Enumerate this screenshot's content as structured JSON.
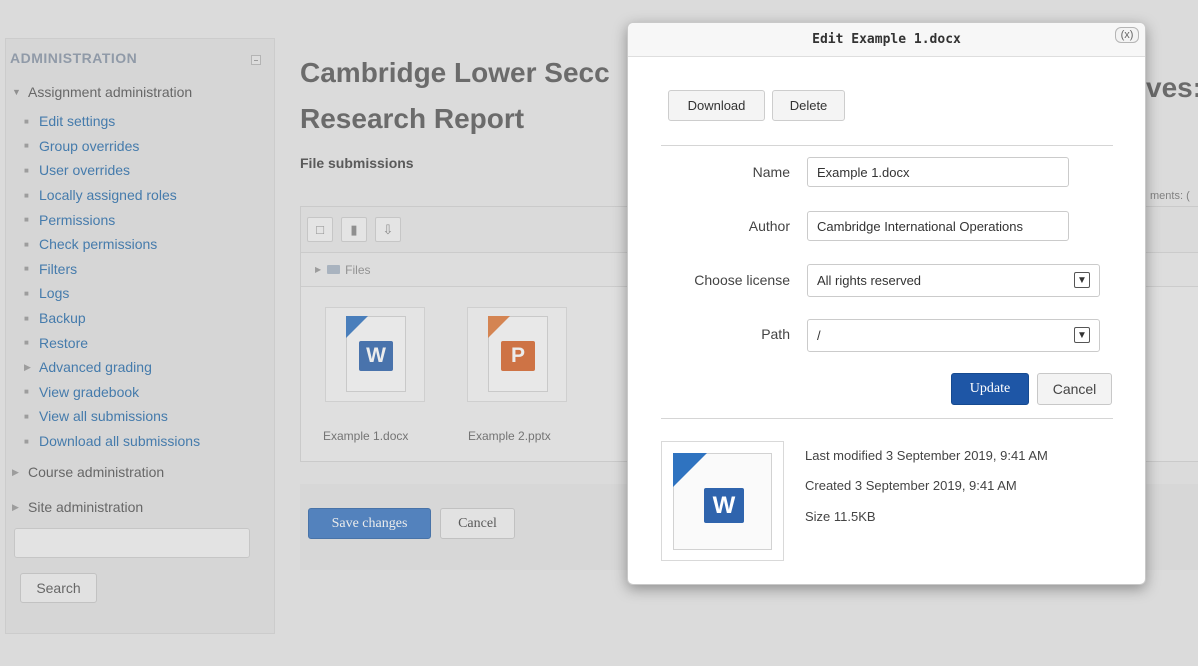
{
  "sidebar": {
    "heading": "ADMINISTRATION",
    "assignment_admin": "Assignment administration",
    "items": [
      {
        "label": "Edit settings"
      },
      {
        "label": "Group overrides"
      },
      {
        "label": "User overrides"
      },
      {
        "label": "Locally assigned roles"
      },
      {
        "label": "Permissions"
      },
      {
        "label": "Check permissions"
      },
      {
        "label": "Filters"
      },
      {
        "label": "Logs"
      },
      {
        "label": "Backup"
      },
      {
        "label": "Restore"
      },
      {
        "label": "Advanced grading"
      },
      {
        "label": "View gradebook"
      },
      {
        "label": "View all submissions"
      },
      {
        "label": "Download all submissions"
      }
    ],
    "course_admin": "Course administration",
    "site_admin": "Site administration",
    "search_value": "",
    "search_button": "Search"
  },
  "main": {
    "title_line1": "Cambridge Lower Secc",
    "title_line2": "Research Report",
    "title_peek": "ves:",
    "comments_peek": "ments: (",
    "file_submissions": "File submissions",
    "path_label": "Files",
    "files": [
      {
        "name": "Example 1.docx",
        "icon": "word-file-icon",
        "letter": "W"
      },
      {
        "name": "Example 2.pptx",
        "icon": "powerpoint-file-icon",
        "letter": "P"
      }
    ],
    "save_button": "Save changes",
    "cancel_button": "Cancel"
  },
  "dialog": {
    "title": "Edit Example 1.docx",
    "close_label": "(x)",
    "download_button": "Download",
    "delete_button": "Delete",
    "fields": {
      "name_label": "Name",
      "name_value": "Example 1.docx",
      "author_label": "Author",
      "author_value": "Cambridge International Operations",
      "license_label": "Choose license",
      "license_value": "All rights reserved",
      "path_label": "Path",
      "path_value": "/"
    },
    "update_button": "Update",
    "cancel_button": "Cancel",
    "preview_letter": "W",
    "meta": {
      "last_modified": "Last modified  3 September 2019, 9:41 AM",
      "created": "Created  3 September 2019, 9:41 AM",
      "size": "Size  11.5KB"
    }
  },
  "colors": {
    "link": "#2a6fad",
    "primary_button": "#3b78c3",
    "update_button": "#1e56a6",
    "word_blue": "#2f64ad",
    "ppt_orange": "#d9652a"
  }
}
